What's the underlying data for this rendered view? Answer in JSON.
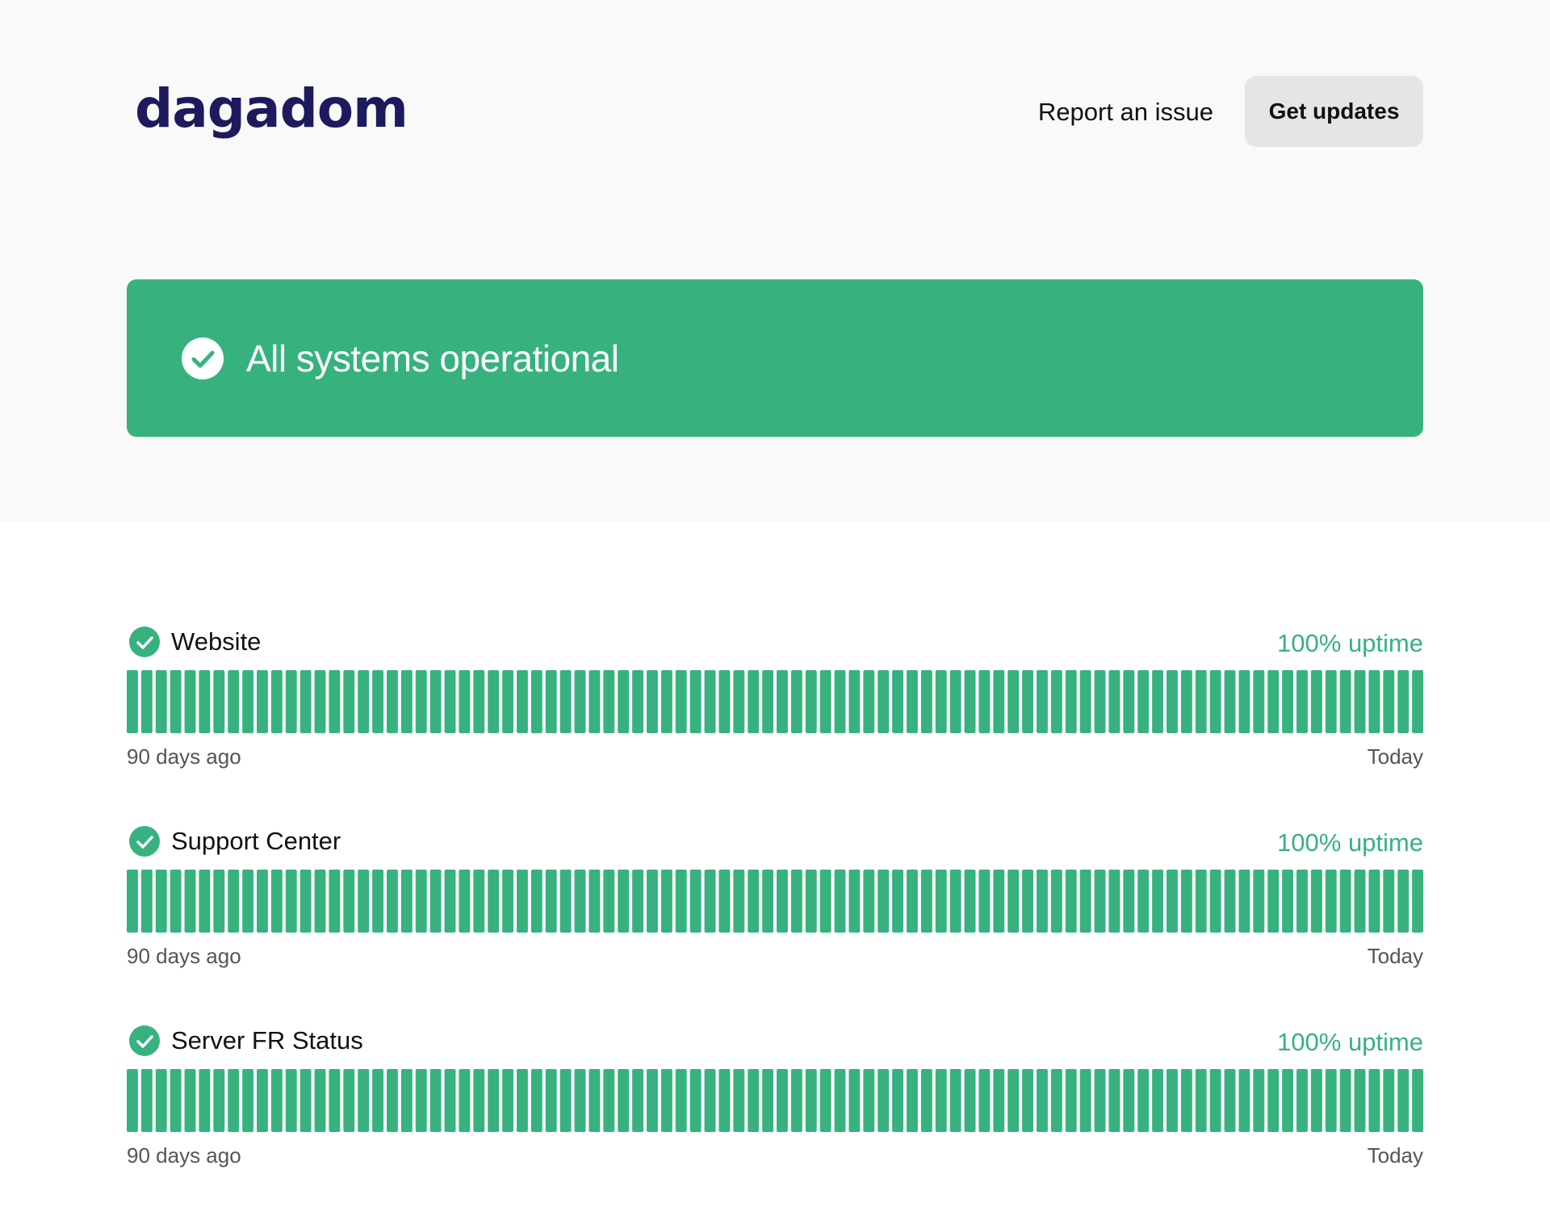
{
  "header": {
    "logo": "dagadom",
    "report_link": "Report an issue",
    "updates_button": "Get updates"
  },
  "banner": {
    "title": "All systems operational",
    "color": "#37b27f"
  },
  "components": [
    {
      "name": "Website",
      "uptime": "100% uptime",
      "start_label": "90 days ago",
      "end_label": "Today",
      "day_status": "operational"
    },
    {
      "name": "Support Center",
      "uptime": "100% uptime",
      "start_label": "90 days ago",
      "end_label": "Today",
      "day_status": "operational"
    },
    {
      "name": "Server FR Status",
      "uptime": "100% uptime",
      "start_label": "90 days ago",
      "end_label": "Today",
      "day_status": "operational"
    }
  ],
  "colors": {
    "operational": "#37b27f",
    "logo": "#1d1a5e",
    "button_bg": "#e5e5e5"
  },
  "icons": {
    "status": "check-circle-icon"
  }
}
